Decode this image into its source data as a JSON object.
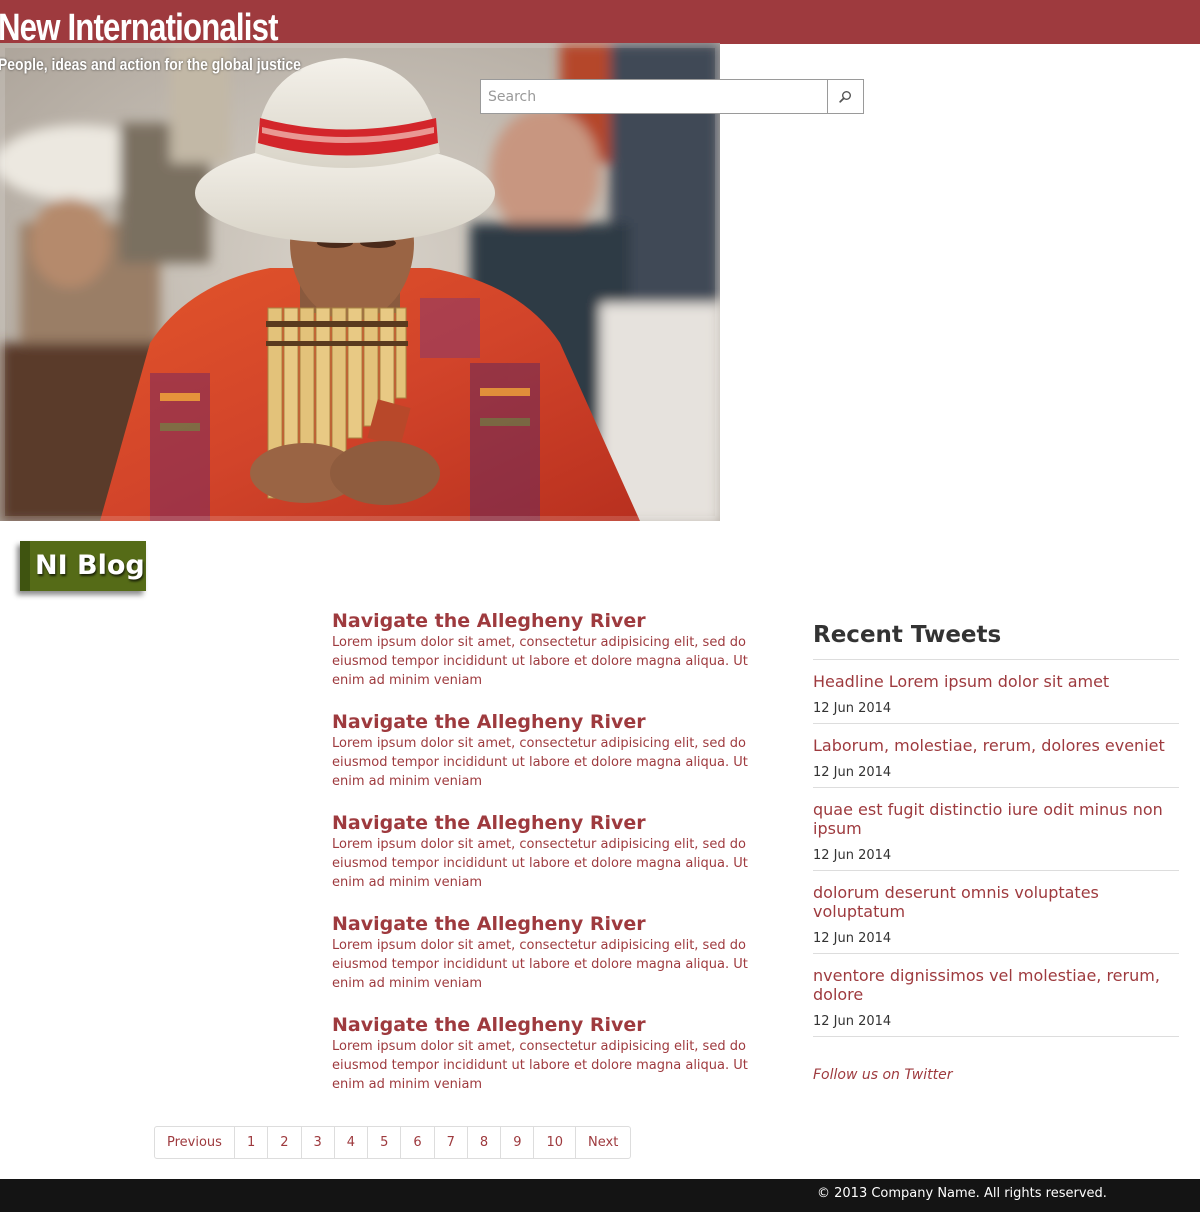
{
  "header": {
    "brand_title": "New Internationalist",
    "tagline": "People, ideas and action for the global justice",
    "bar_color": "#9e3a3e"
  },
  "hero": {
    "image": "man-in-white-hat-playing-pan-flute"
  },
  "search": {
    "placeholder": "Search",
    "button_icon": "search-icon"
  },
  "blog_badge": {
    "label": "NI Blog",
    "color": "#556b17"
  },
  "posts": [
    {
      "title": "Navigate the Allegheny River",
      "excerpt": "Lorem ipsum dolor sit amet, consectetur adipisicing elit, sed do eiusmod tempor incididunt ut labore et dolore magna aliqua. Ut enim ad minim veniam"
    },
    {
      "title": "Navigate the Allegheny River",
      "excerpt": "Lorem ipsum dolor sit amet, consectetur adipisicing elit, sed do eiusmod tempor incididunt ut labore et dolore magna aliqua. Ut enim ad minim veniam"
    },
    {
      "title": "Navigate the Allegheny River",
      "excerpt": "Lorem ipsum dolor sit amet, consectetur adipisicing elit, sed do eiusmod tempor incididunt ut labore et dolore magna aliqua. Ut enim ad minim veniam"
    },
    {
      "title": "Navigate the Allegheny River",
      "excerpt": "Lorem ipsum dolor sit amet, consectetur adipisicing elit, sed do eiusmod tempor incididunt ut labore et dolore magna aliqua. Ut enim ad minim veniam"
    },
    {
      "title": "Navigate the Allegheny River",
      "excerpt": "Lorem ipsum dolor sit amet, consectetur adipisicing elit, sed do eiusmod tempor incididunt ut labore et dolore magna aliqua. Ut enim ad minim veniam"
    }
  ],
  "sidebar": {
    "heading": "Recent Tweets",
    "tweets": [
      {
        "text": "Headline Lorem ipsum dolor sit amet",
        "date": "12 Jun 2014"
      },
      {
        "text": "Laborum, molestiae, rerum, dolores eveniet",
        "date": "12 Jun 2014"
      },
      {
        "text": "quae est fugit distinctio iure odit minus non ipsum",
        "date": "12 Jun 2014"
      },
      {
        "text": "dolorum deserunt omnis voluptates voluptatum",
        "date": "12 Jun 2014"
      },
      {
        "text": "nventore dignissimos vel molestiae, rerum, dolore",
        "date": "12 Jun 2014"
      }
    ],
    "follow_label": "Follow us on Twitter"
  },
  "pagination": {
    "previous": "Previous",
    "pages": [
      "1",
      "2",
      "3",
      "4",
      "5",
      "6",
      "7",
      "8",
      "9",
      "10"
    ],
    "next": "Next"
  },
  "footer": {
    "copyright": "© 2013 Company Name. All rights reserved."
  }
}
